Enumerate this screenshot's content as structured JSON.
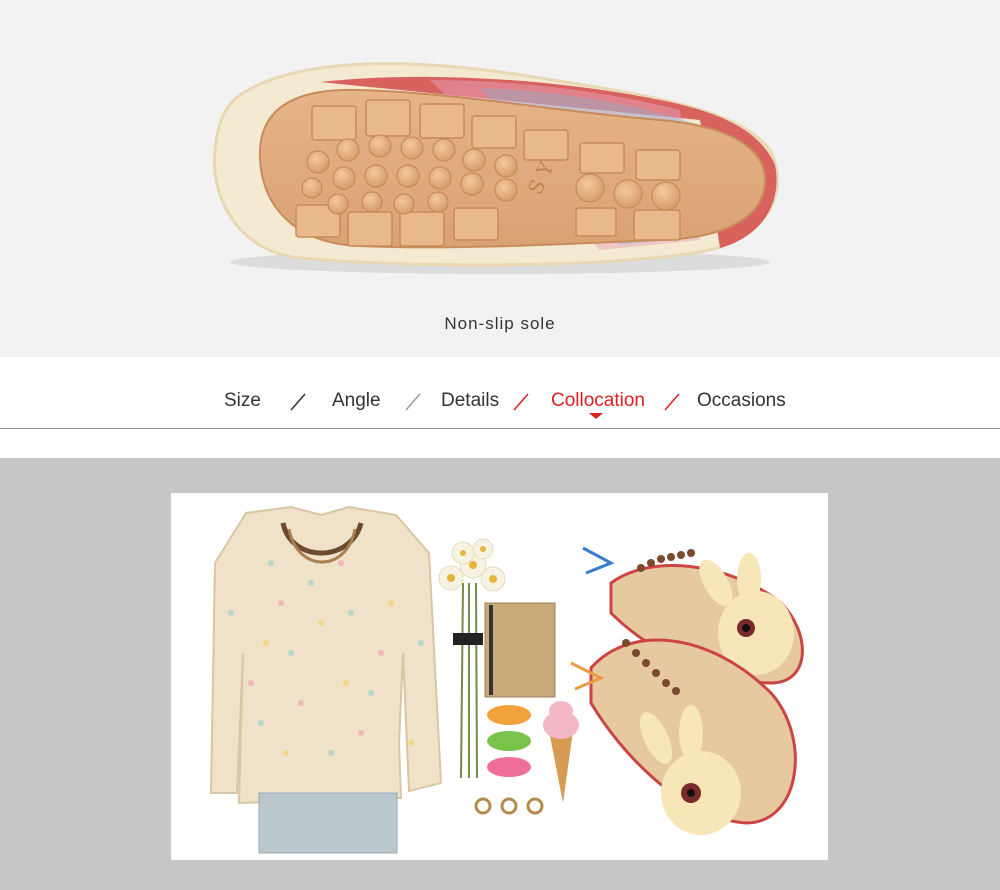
{
  "sole_section": {
    "caption": "Non-slip sole",
    "image_name": "shoe-sole-photo"
  },
  "nav": {
    "items": [
      {
        "label": "Size",
        "active": false
      },
      {
        "label": "Angle",
        "active": false
      },
      {
        "label": "Details",
        "active": false
      },
      {
        "label": "Collocation",
        "active": true
      },
      {
        "label": "Occasions",
        "active": false
      }
    ],
    "active_color": "#e02020",
    "separator_colors": [
      "#333333",
      "#999999",
      "#e02020",
      "#e02020"
    ]
  },
  "collocation": {
    "image_name": "outfit-collocation-photo",
    "background": "#c7c7c7"
  }
}
